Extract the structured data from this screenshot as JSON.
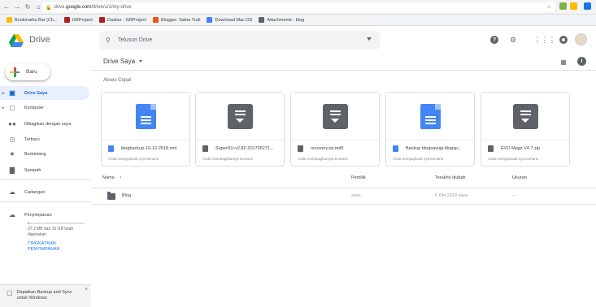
{
  "browser": {
    "url_prefix": "drive.",
    "url_host": "google.com",
    "url_path": "/drive/u/1/my-drive",
    "bookmarks": [
      {
        "label": "Bookmarks Bar (Ch...",
        "color": "#fbbc04"
      },
      {
        "label": "GRProject",
        "color": "#b71c1c"
      },
      {
        "label": "Dasbor - GRProject",
        "color": "#b71c1c"
      },
      {
        "label": "Blogger: Satria Yudi",
        "color": "#f4511e"
      },
      {
        "label": "Download Mac OS",
        "color": "#4285f4"
      },
      {
        "label": "Attachments - blog",
        "color": "#5f6368"
      }
    ]
  },
  "header": {
    "app_name": "Drive",
    "search_placeholder": "Telusuri Drive"
  },
  "sidebar": {
    "new_label": "Baru",
    "items": [
      {
        "label": "Drive Saya",
        "icon": "drive-icon",
        "active": true
      },
      {
        "label": "Komputer",
        "icon": "computer-icon"
      },
      {
        "label": "Dibagikan dengan saya",
        "icon": "people-icon"
      },
      {
        "label": "Terbaru",
        "icon": "clock-icon"
      },
      {
        "label": "Berbintang",
        "icon": "star-icon"
      },
      {
        "label": "Sampah",
        "icon": "trash-icon"
      },
      {
        "label": "Cadangan",
        "icon": "cloud-icon"
      },
      {
        "label": "Penyimpanan",
        "icon": "cloud-outline-icon"
      }
    ],
    "storage_usage": 0.0025,
    "storage_text": "37,2 MB dari 15 GB telah digunakan",
    "upgrade_label": "TINGKATKAN PENYIMPANAN",
    "toast_text": "Dapatkan Backup and Sync untuk Windows"
  },
  "main": {
    "breadcrumb": "Drive Saya",
    "quick_access_title": "Akses Cepat",
    "quick_access": [
      {
        "name": "blogbackup-10-12-2018.xml",
        "sub": "Anda mengupload nya kemarin",
        "type": "doc"
      },
      {
        "name": "SuperSU-v2.82-201705271...",
        "sub": "Anda membagikannya kemarin",
        "type": "archive"
      },
      {
        "name": "recovery.tar.md5",
        "sub": "Anda membagikannya kemarin",
        "type": "archive"
      },
      {
        "name": "Backup blogsayugi.blogsp...",
        "sub": "Anda mengupload nya kemarin",
        "type": "doc"
      },
      {
        "name": "EVO Magz V4.7.zip",
        "sub": "Anda mengupload nya kemarin",
        "type": "archive"
      }
    ],
    "columns": {
      "name": "Nama",
      "owner": "Pemilik",
      "modified": "Terakhir diubah",
      "size": "Ukuran"
    },
    "rows": [
      {
        "name": "Blog",
        "owner": "saya",
        "modified_date": "6 Okt 2018",
        "modified_by": "saya",
        "size": "–"
      }
    ]
  },
  "colors": {
    "accent": "#1a73e8",
    "doc_blue": "#4285f4",
    "archive_gray": "#5f6368"
  }
}
